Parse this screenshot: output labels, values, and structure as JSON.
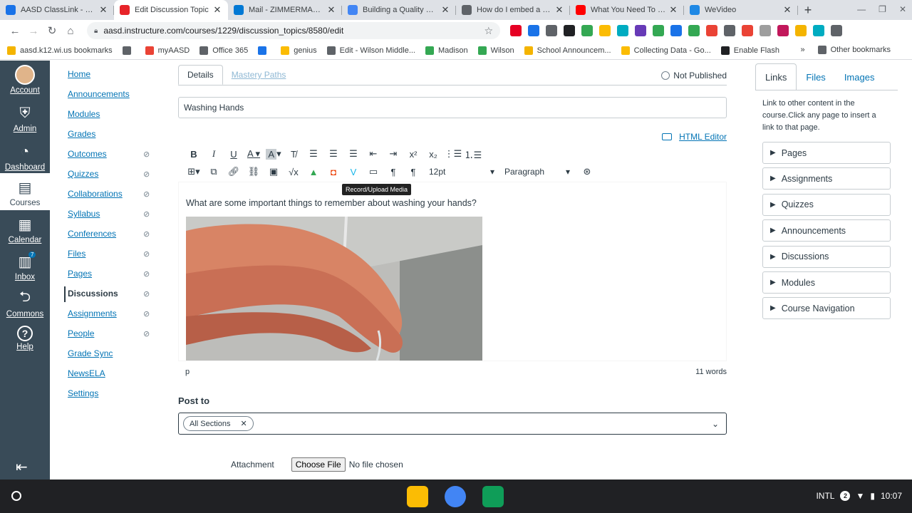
{
  "browser": {
    "tabs": [
      {
        "title": "AASD ClassLink - My Apps",
        "color": "#1a73e8"
      },
      {
        "title": "Edit Discussion Topic",
        "color": "#e72429",
        "active": true
      },
      {
        "title": "Mail - ZIMMERMANN, B",
        "color": "#0078d4"
      },
      {
        "title": "Building a Quality Digital",
        "color": "#4285f4"
      },
      {
        "title": "How do I embed a video",
        "color": "#5f6368"
      },
      {
        "title": "What You Need To Know",
        "color": "#ff0000"
      },
      {
        "title": "WeVideo",
        "color": "#1e88e5"
      }
    ],
    "new_tab": "+",
    "url": "aasd.instructure.com/courses/1229/discussion_topics/8580/edit",
    "ext_colors": [
      "#e60023",
      "#1a73e8",
      "#5f6368",
      "#202124",
      "#34a853",
      "#fbbc04",
      "#00acc1",
      "#673ab7",
      "#34a853",
      "#1a73e8",
      "#34a853",
      "#ea4335",
      "#5f6368",
      "#ea4335",
      "#9e9e9e",
      "#c2185b",
      "#f4b400",
      "#00acc1",
      "#5f6368"
    ],
    "bookmarks": [
      {
        "label": "aasd.k12.wi.us bookmarks",
        "color": "#f4b400"
      },
      {
        "label": "",
        "color": "#5f6368"
      },
      {
        "label": "myAASD",
        "color": "#ea4335"
      },
      {
        "label": "Office 365",
        "color": "#5f6368"
      },
      {
        "label": "",
        "color": "#1a73e8"
      },
      {
        "label": "genius",
        "color": "#fbbc04"
      },
      {
        "label": "Edit - Wilson Middle...",
        "color": "#5f6368"
      },
      {
        "label": "Madison",
        "color": "#34a853"
      },
      {
        "label": "Wilson",
        "color": "#34a853"
      },
      {
        "label": "School Announcem...",
        "color": "#f4b400"
      },
      {
        "label": "Collecting Data - Go...",
        "color": "#fbbc04"
      },
      {
        "label": "Enable Flash",
        "color": "#202124"
      }
    ],
    "more_bookmarks": "»",
    "other_bookmarks": "Other bookmarks"
  },
  "global_nav": [
    {
      "label": "Account",
      "icon": "avatar"
    },
    {
      "label": "Admin",
      "icon": "shield-icon"
    },
    {
      "label": "Dashboard",
      "icon": "gauge-icon"
    },
    {
      "label": "Courses",
      "icon": "book-icon",
      "active": true
    },
    {
      "label": "Calendar",
      "icon": "calendar-icon"
    },
    {
      "label": "Inbox",
      "icon": "inbox-icon",
      "badge": "7"
    },
    {
      "label": "Commons",
      "icon": "commons-icon"
    },
    {
      "label": "Help",
      "icon": "help-icon"
    }
  ],
  "course_nav": [
    {
      "label": "Home",
      "hidden": false
    },
    {
      "label": "Announcements",
      "hidden": false
    },
    {
      "label": "Modules",
      "hidden": false
    },
    {
      "label": "Grades",
      "hidden": false
    },
    {
      "label": "Outcomes",
      "hidden": true
    },
    {
      "label": "Quizzes",
      "hidden": true
    },
    {
      "label": "Collaborations",
      "hidden": true
    },
    {
      "label": "Syllabus",
      "hidden": true
    },
    {
      "label": "Conferences",
      "hidden": true
    },
    {
      "label": "Files",
      "hidden": true
    },
    {
      "label": "Pages",
      "hidden": true
    },
    {
      "label": "Discussions",
      "hidden": true,
      "active": true
    },
    {
      "label": "Assignments",
      "hidden": true
    },
    {
      "label": "People",
      "hidden": true
    },
    {
      "label": "Grade Sync",
      "hidden": false
    },
    {
      "label": "NewsELA",
      "hidden": false
    },
    {
      "label": "Settings",
      "hidden": false
    }
  ],
  "main": {
    "tabs": [
      "Details",
      "Mastery Paths"
    ],
    "publish_status": "Not Published",
    "title_value": "Washing Hands",
    "html_editor": "HTML Editor",
    "font_size": "12pt",
    "block_format": "Paragraph",
    "tooltip": "Record/Upload Media",
    "question": "What are some important things to remember about washing your hands?",
    "path": "p",
    "word_count": "11 words",
    "post_to_label": "Post to",
    "section_chip": "All Sections",
    "attachment_label": "Attachment",
    "choose_file": "Choose File",
    "no_file": "No file chosen"
  },
  "right_sidebar": {
    "tabs": [
      "Links",
      "Files",
      "Images"
    ],
    "help_text": "Link to other content in the course.Click any page to insert a link to that page.",
    "sections": [
      "Pages",
      "Assignments",
      "Quizzes",
      "Announcements",
      "Discussions",
      "Modules",
      "Course Navigation"
    ]
  },
  "shelf": {
    "ime": "INTL",
    "notif": "2",
    "time": "10:07",
    "apps": [
      {
        "name": "keep",
        "color": "#fbbc04"
      },
      {
        "name": "chrome",
        "color": "#4285f4"
      },
      {
        "name": "classroom",
        "color": "#0f9d58"
      }
    ]
  }
}
